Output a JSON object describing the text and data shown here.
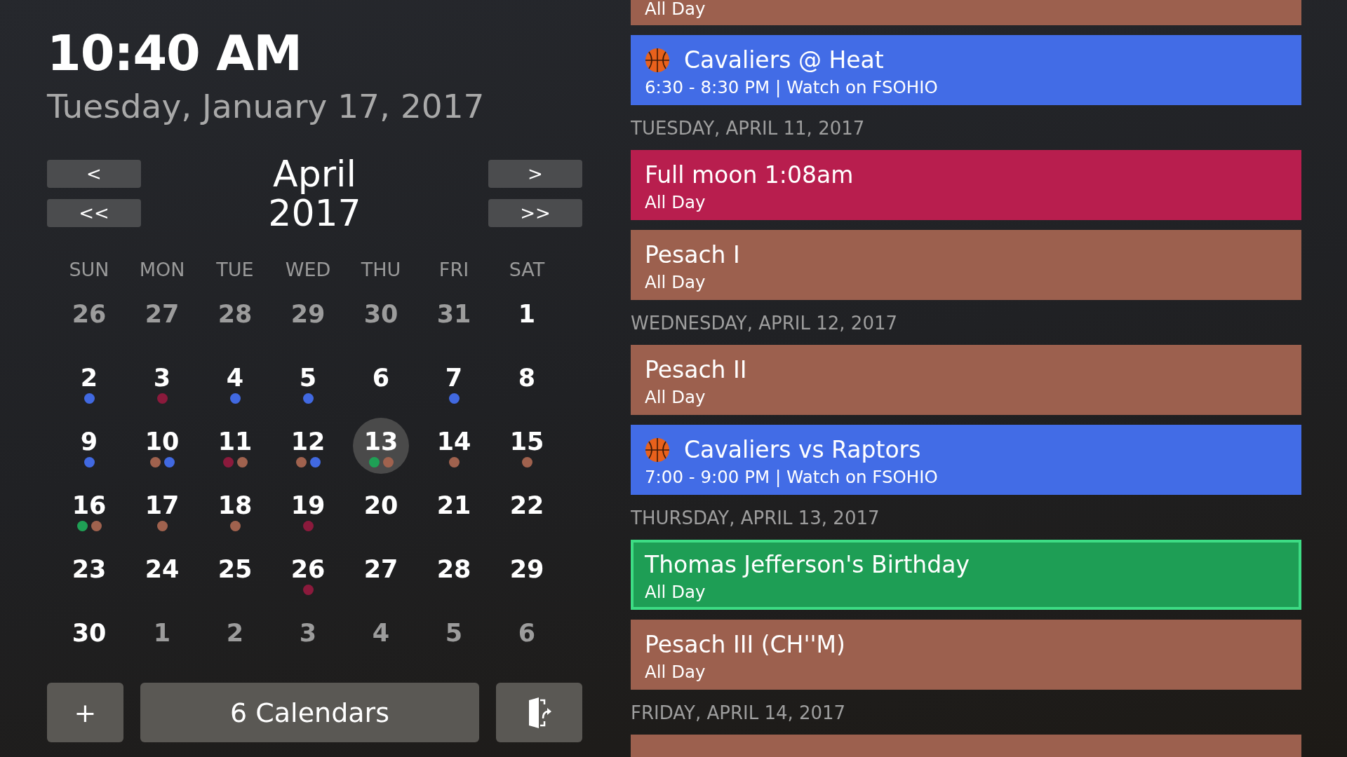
{
  "clock": {
    "time": "10:40 AM",
    "date": "Tuesday, January 17, 2017"
  },
  "nav": {
    "prev": "<",
    "prev_year": "<<",
    "next": ">",
    "next_year": ">>",
    "month": "April",
    "year": "2017"
  },
  "weekdays": [
    "SUN",
    "MON",
    "TUE",
    "WED",
    "THU",
    "FRI",
    "SAT"
  ],
  "days": [
    {
      "label": "26",
      "muted": true,
      "selected": false
    },
    {
      "label": "27",
      "muted": true,
      "selected": false
    },
    {
      "label": "28",
      "muted": true,
      "selected": false
    },
    {
      "label": "29",
      "muted": true,
      "selected": false
    },
    {
      "label": "30",
      "muted": true,
      "selected": false
    },
    {
      "label": "31",
      "muted": true,
      "selected": false
    },
    {
      "label": "1",
      "muted": false,
      "selected": false
    },
    {
      "label": "2",
      "muted": false,
      "selected": false,
      "dots": [
        {
          "color": "#4169e1"
        }
      ]
    },
    {
      "label": "3",
      "muted": false,
      "selected": false,
      "dots": [
        {
          "color": "#8b1a3c"
        }
      ]
    },
    {
      "label": "4",
      "muted": false,
      "selected": false,
      "dots": [
        {
          "color": "#4169e1"
        }
      ]
    },
    {
      "label": "5",
      "muted": false,
      "selected": false,
      "dots": [
        {
          "color": "#4169e1"
        }
      ]
    },
    {
      "label": "6",
      "muted": false,
      "selected": false
    },
    {
      "label": "7",
      "muted": false,
      "selected": false,
      "dots": [
        {
          "color": "#4169e1"
        }
      ]
    },
    {
      "label": "8",
      "muted": false,
      "selected": false
    },
    {
      "label": "9",
      "muted": false,
      "selected": false,
      "dots": [
        {
          "color": "#4169e1"
        }
      ]
    },
    {
      "label": "10",
      "muted": false,
      "selected": false,
      "dots": [
        {
          "color": "#a0624e"
        },
        {
          "color": "#4169e1"
        }
      ]
    },
    {
      "label": "11",
      "muted": false,
      "selected": false,
      "dots": [
        {
          "color": "#8b1a3c"
        },
        {
          "color": "#a0624e"
        }
      ]
    },
    {
      "label": "12",
      "muted": false,
      "selected": false,
      "dots": [
        {
          "color": "#a0624e"
        },
        {
          "color": "#4169e1"
        }
      ]
    },
    {
      "label": "13",
      "muted": false,
      "selected": true,
      "dots": [
        {
          "color": "#1fa055"
        },
        {
          "color": "#a0624e"
        }
      ]
    },
    {
      "label": "14",
      "muted": false,
      "selected": false,
      "dots": [
        {
          "color": "#a0624e"
        }
      ]
    },
    {
      "label": "15",
      "muted": false,
      "selected": false,
      "dots": [
        {
          "color": "#a0624e"
        }
      ]
    },
    {
      "label": "16",
      "muted": false,
      "selected": false,
      "dots": [
        {
          "color": "#1fa055"
        },
        {
          "color": "#a0624e"
        }
      ]
    },
    {
      "label": "17",
      "muted": false,
      "selected": false,
      "dots": [
        {
          "color": "#a0624e"
        }
      ]
    },
    {
      "label": "18",
      "muted": false,
      "selected": false,
      "dots": [
        {
          "color": "#a0624e"
        }
      ]
    },
    {
      "label": "19",
      "muted": false,
      "selected": false,
      "dots": [
        {
          "color": "#8b1a3c"
        }
      ]
    },
    {
      "label": "20",
      "muted": false,
      "selected": false
    },
    {
      "label": "21",
      "muted": false,
      "selected": false
    },
    {
      "label": "22",
      "muted": false,
      "selected": false
    },
    {
      "label": "23",
      "muted": false,
      "selected": false
    },
    {
      "label": "24",
      "muted": false,
      "selected": false
    },
    {
      "label": "25",
      "muted": false,
      "selected": false
    },
    {
      "label": "26",
      "muted": false,
      "selected": false,
      "dots": [
        {
          "color": "#8b1a3c"
        }
      ]
    },
    {
      "label": "27",
      "muted": false,
      "selected": false
    },
    {
      "label": "28",
      "muted": false,
      "selected": false
    },
    {
      "label": "29",
      "muted": false,
      "selected": false
    },
    {
      "label": "30",
      "muted": false,
      "selected": false
    },
    {
      "label": "1",
      "muted": true,
      "selected": false
    },
    {
      "label": "2",
      "muted": true,
      "selected": false
    },
    {
      "label": "3",
      "muted": true,
      "selected": false
    },
    {
      "label": "4",
      "muted": true,
      "selected": false
    },
    {
      "label": "5",
      "muted": true,
      "selected": false
    },
    {
      "label": "6",
      "muted": true,
      "selected": false
    }
  ],
  "footer": {
    "add": "+",
    "calendars": "6 Calendars"
  },
  "agenda": [
    {
      "kind": "partial",
      "subtitle": "All Day",
      "color": "#9c604e"
    },
    {
      "kind": "game",
      "title": "Cavaliers @ Heat",
      "subtitle": "6:30 - 8:30 PM | Watch on FSOHIO",
      "color": "#426ce6",
      "selected": false
    },
    {
      "kind": "heading",
      "text": "TUESDAY, APRIL 11, 2017"
    },
    {
      "kind": "event",
      "title": "Full moon 1:08am",
      "subtitle": "All Day",
      "color": "#b81e4e",
      "selected": false
    },
    {
      "kind": "event",
      "title": "Pesach I",
      "subtitle": "All Day",
      "color": "#9c604e",
      "selected": false
    },
    {
      "kind": "heading",
      "text": "WEDNESDAY, APRIL 12, 2017"
    },
    {
      "kind": "event",
      "title": "Pesach II",
      "subtitle": "All Day",
      "color": "#9c604e",
      "selected": false
    },
    {
      "kind": "game",
      "title": "Cavaliers vs Raptors",
      "subtitle": "7:00 - 9:00 PM | Watch on FSOHIO",
      "color": "#426ce6",
      "selected": false
    },
    {
      "kind": "heading",
      "text": "THURSDAY, APRIL 13, 2017"
    },
    {
      "kind": "event",
      "title": "Thomas Jefferson's Birthday",
      "subtitle": "All Day",
      "color": "#1e9e55",
      "selected": true
    },
    {
      "kind": "event",
      "title": "Pesach III (CH''M)",
      "subtitle": "All Day",
      "color": "#9c604e",
      "selected": false
    },
    {
      "kind": "heading",
      "text": "FRIDAY, APRIL 14, 2017"
    },
    {
      "kind": "cut",
      "color": "#9c604e"
    }
  ]
}
